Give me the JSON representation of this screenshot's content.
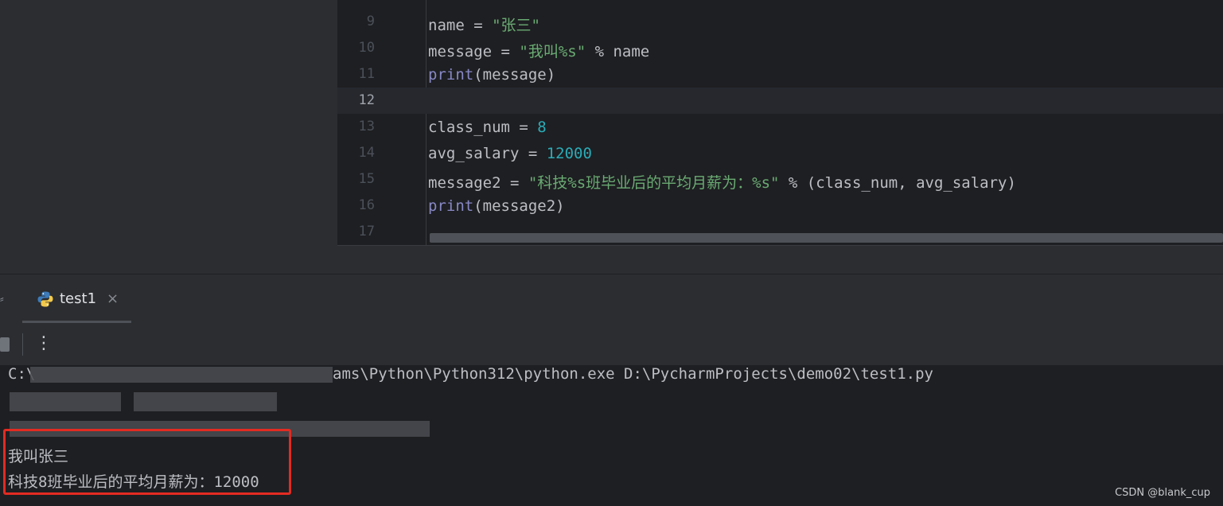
{
  "editor": {
    "lines": [
      {
        "num": "9",
        "code": "name = \"张三\""
      },
      {
        "num": "10",
        "code": "message = \"我叫%s\" % name"
      },
      {
        "num": "11",
        "code": "print(message)"
      },
      {
        "num": "12",
        "code": ""
      },
      {
        "num": "13",
        "code": "class_num = 8"
      },
      {
        "num": "14",
        "code": "avg_salary = 12000"
      },
      {
        "num": "15",
        "code": "message2 = \"科技%s班毕业后的平均月薪为：%s\" % (class_num, avg_salary)"
      },
      {
        "num": "16",
        "code": "print(message2)"
      },
      {
        "num": "17",
        "code": ""
      }
    ],
    "current_line": "12"
  },
  "run_panel": {
    "tab_label": "test1",
    "tab_close_glyph": "×",
    "more_glyph": "⋮",
    "left_glyph": "⸗",
    "console": {
      "command_prefix": "C:\\",
      "command_suffix": "ams\\Python\\Python312\\python.exe D:\\PycharmProjects\\demo02\\test1.py",
      "output": [
        "我叫张三",
        "科技8班毕业后的平均月薪为：12000"
      ]
    }
  },
  "watermark": "CSDN @blank_cup",
  "colors": {
    "editor_bg": "#1e1f22",
    "panel_bg": "#2b2d30",
    "string": "#6aab73",
    "number": "#2aacb8",
    "builtin": "#8888c6",
    "highlight_box": "#e32b22"
  }
}
